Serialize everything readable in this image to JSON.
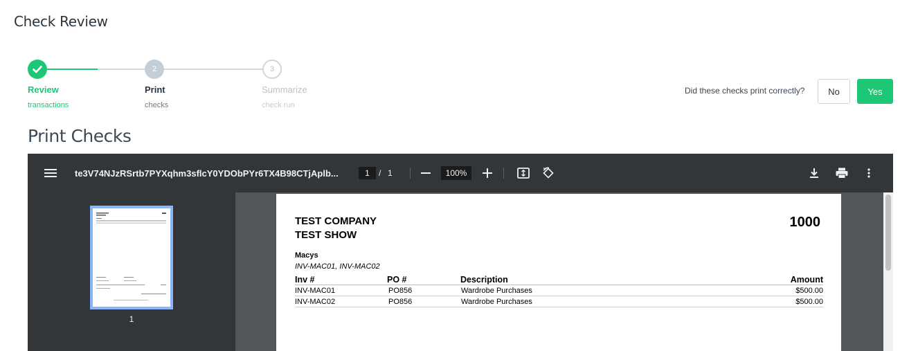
{
  "page": {
    "title": "Check Review"
  },
  "stepper": {
    "steps": [
      {
        "label": "Review",
        "sub": "transactions",
        "state": "done"
      },
      {
        "label": "Print",
        "sub": "checks",
        "number": "2",
        "state": "current"
      },
      {
        "label": "Summarize",
        "sub": "check run",
        "number": "3",
        "state": "future"
      }
    ]
  },
  "confirm": {
    "question": "Did these checks print correctly?",
    "no_label": "No",
    "yes_label": "Yes"
  },
  "section": {
    "title": "Print Checks"
  },
  "viewer": {
    "filename": "te3V74NJzRSrtb7PYXqhm3sflcY0YDObPYr6TX4B98CTjAplb...",
    "current_page": "1",
    "page_separator": "/",
    "total_pages": "1",
    "zoom": "100%",
    "thumbnail_page": "1",
    "icons": [
      "menu-icon",
      "zoom-out-icon",
      "zoom-in-icon",
      "fit-page-icon",
      "rotate-icon",
      "download-icon",
      "print-icon",
      "more-vert-icon"
    ]
  },
  "document": {
    "company_line1": "TEST COMPANY",
    "company_line2": "TEST SHOW",
    "check_number": "1000",
    "payee": "Macys",
    "invoice_list": "INV-MAC01, INV-MAC02",
    "columns": [
      "Inv #",
      "PO #",
      "Description",
      "Amount"
    ],
    "rows": [
      [
        "INV-MAC01",
        "PO856",
        "Wardrobe Purchases",
        "$500.00"
      ],
      [
        "INV-MAC02",
        "PO856",
        "Wardrobe Purchases",
        "$500.00"
      ]
    ]
  },
  "colors": {
    "accent": "#1ec776",
    "toolbar": "#323639",
    "viewer_bg": "#525659",
    "thumb_border": "#8ab4f8"
  }
}
